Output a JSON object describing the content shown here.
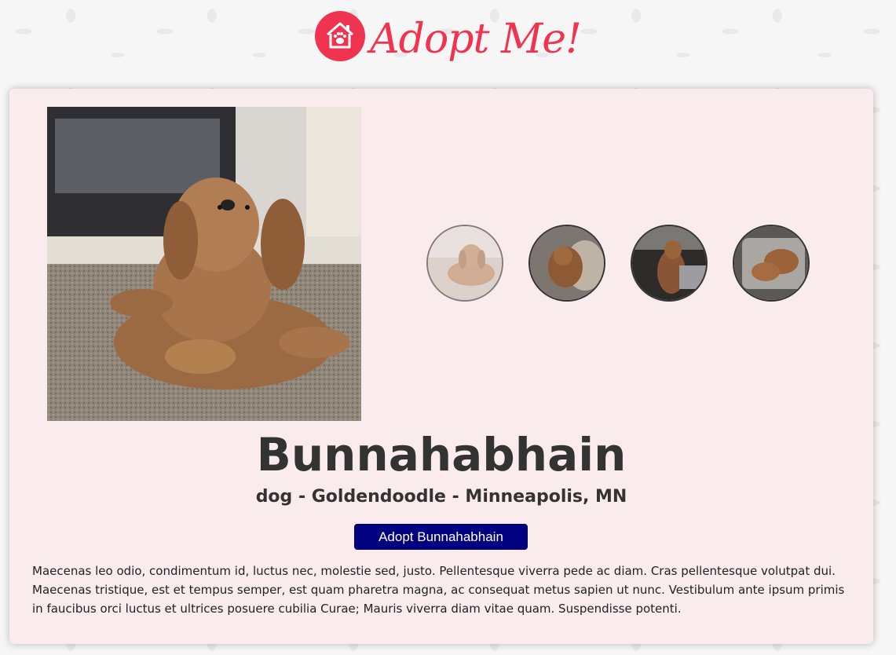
{
  "header": {
    "logo_text": "Adopt Me!",
    "brand_color": "#f0334f"
  },
  "pet": {
    "name": "Bunnahabhain",
    "subtitle": "dog - Goldendoodle - Minneapolis, MN",
    "adopt_label": "Adopt Bunnahabhain",
    "description": "Maecenas leo odio, condimentum id, luctus nec, molestie sed, justo. Pellentesque viverra pede ac diam. Cras pellentesque volutpat dui. Maecenas tristique, est et tempus semper, est quam pharetra magna, ac consequat metus sapien ut nunc. Vestibulum ante ipsum primis in faucibus orci luctus et ultrices posuere cubilia Curae; Mauris viverra diam vitae quam. Suspendisse potenti."
  },
  "carousel": {
    "active_index": 0,
    "thumbnail_count": 4
  },
  "colors": {
    "card_bg": "#faebed",
    "button_bg": "#000080",
    "text": "#333333"
  }
}
